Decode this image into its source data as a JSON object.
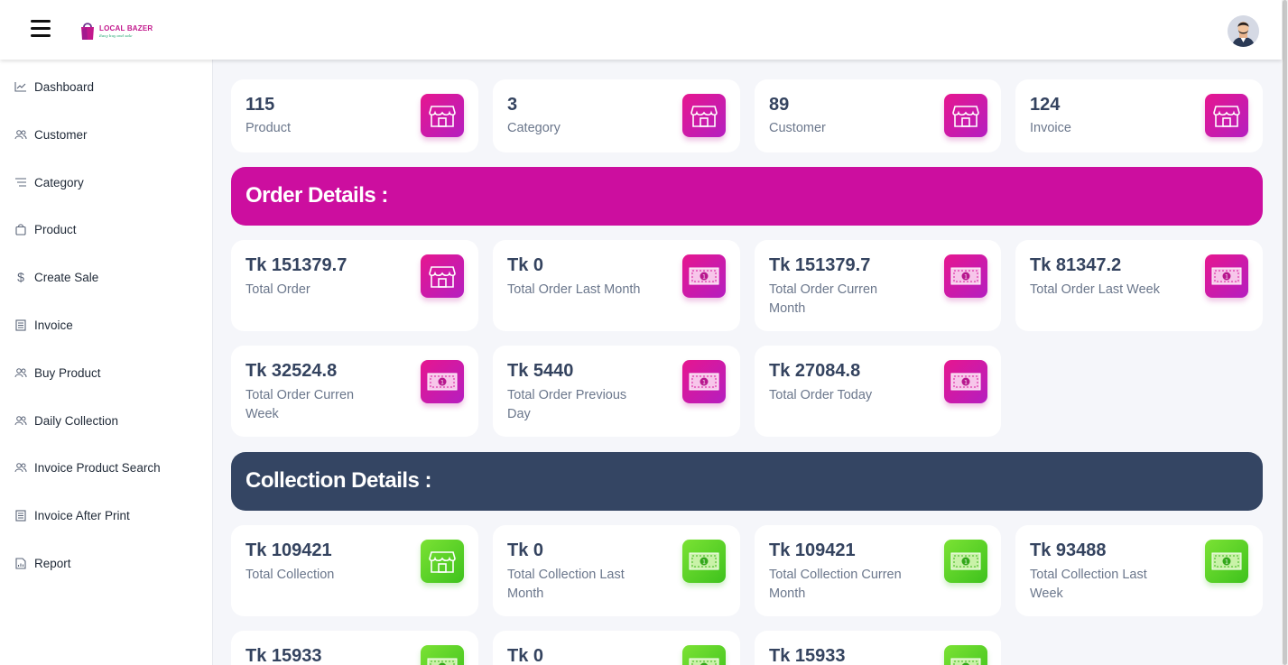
{
  "header": {
    "logo_title": "LOCAL BAZER",
    "logo_tagline": "Easy buy and sale"
  },
  "sidebar": {
    "items": [
      {
        "label": "Dashboard",
        "icon": "chart-line-icon"
      },
      {
        "label": "Customer",
        "icon": "users-icon"
      },
      {
        "label": "Category",
        "icon": "list-icon"
      },
      {
        "label": "Product",
        "icon": "shopping-bag-icon"
      },
      {
        "label": "Create Sale",
        "icon": "dollar-icon"
      },
      {
        "label": "Invoice",
        "icon": "document-icon"
      },
      {
        "label": "Buy Product",
        "icon": "users-icon"
      },
      {
        "label": "Daily Collection",
        "icon": "users-icon"
      },
      {
        "label": "Invoice Product Search",
        "icon": "users-icon"
      },
      {
        "label": "Invoice After Print",
        "icon": "document-icon"
      },
      {
        "label": "Report",
        "icon": "report-icon"
      }
    ]
  },
  "summary_cards": [
    {
      "value": "115",
      "label": "Product",
      "icon": "store-icon"
    },
    {
      "value": "3",
      "label": "Category",
      "icon": "store-icon"
    },
    {
      "value": "89",
      "label": "Customer",
      "icon": "store-icon"
    },
    {
      "value": "124",
      "label": "Invoice",
      "icon": "store-icon"
    }
  ],
  "order_section": {
    "title": "Order Details :",
    "cards": [
      {
        "value": "Tk 151379.7",
        "label": "Total Order",
        "icon": "store-icon"
      },
      {
        "value": "Tk 0",
        "label": "Total Order Last Month",
        "icon": "money-icon"
      },
      {
        "value": "Tk 151379.7",
        "label": "Total Order Curren Month",
        "icon": "money-icon"
      },
      {
        "value": "Tk 81347.2",
        "label": "Total Order Last Week",
        "icon": "money-icon"
      },
      {
        "value": "Tk 32524.8",
        "label": "Total Order Curren Week",
        "icon": "money-icon"
      },
      {
        "value": "Tk 5440",
        "label": "Total Order Previous Day",
        "icon": "money-icon"
      },
      {
        "value": "Tk 27084.8",
        "label": "Total Order Today",
        "icon": "money-icon"
      }
    ]
  },
  "collection_section": {
    "title": "Collection Details :",
    "cards": [
      {
        "value": "Tk 109421",
        "label": "Total Collection",
        "icon": "store-icon"
      },
      {
        "value": "Tk 0",
        "label": "Total Collection Last Month",
        "icon": "money-icon"
      },
      {
        "value": "Tk 109421",
        "label": "Total Collection Curren Month",
        "icon": "money-icon"
      },
      {
        "value": "Tk 93488",
        "label": "Total Collection Last Week",
        "icon": "money-icon"
      },
      {
        "value": "Tk 15933",
        "label": "",
        "icon": "money-icon"
      },
      {
        "value": "Tk 0",
        "label": "",
        "icon": "money-icon"
      },
      {
        "value": "Tk 15933",
        "label": "",
        "icon": "money-icon"
      }
    ]
  },
  "colors": {
    "order_banner": "#cc0e9f",
    "collection_banner": "#344563",
    "pink_icon": "#e6168f",
    "green_icon": "#5cd02a"
  }
}
